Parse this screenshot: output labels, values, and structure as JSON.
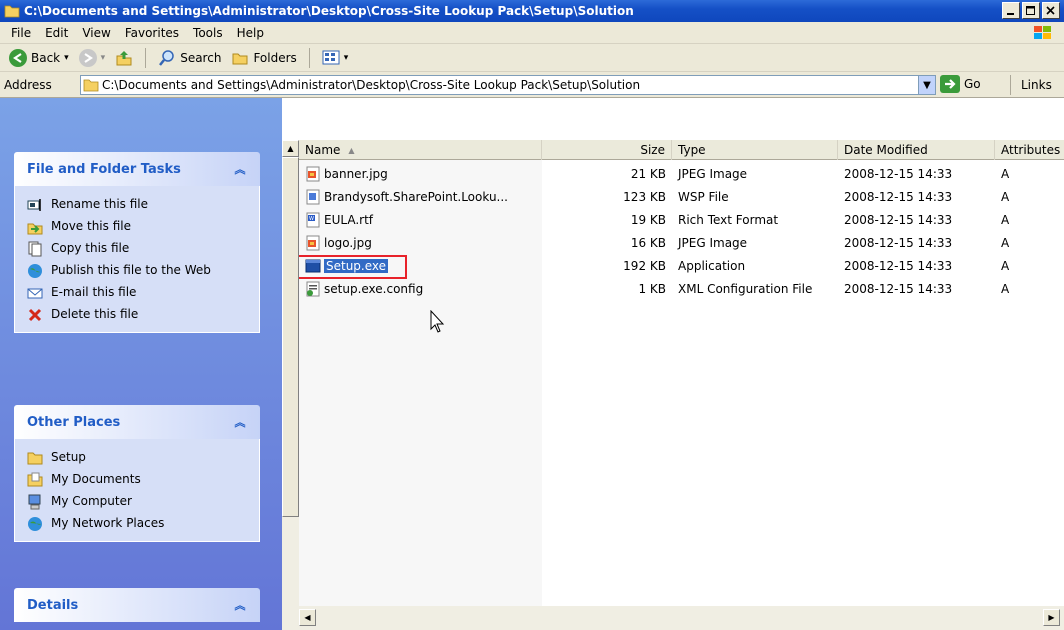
{
  "window": {
    "title": "C:\\Documents and Settings\\Administrator\\Desktop\\Cross-Site Lookup Pack\\Setup\\Solution"
  },
  "menu": {
    "items": [
      "File",
      "Edit",
      "View",
      "Favorites",
      "Tools",
      "Help"
    ]
  },
  "toolbar": {
    "back": "Back",
    "search": "Search",
    "folders": "Folders"
  },
  "address": {
    "label": "Address",
    "value": "C:\\Documents and Settings\\Administrator\\Desktop\\Cross-Site Lookup Pack\\Setup\\Solution",
    "go": "Go",
    "links": "Links"
  },
  "tasks": {
    "file_folder": {
      "title": "File and Folder Tasks",
      "items": [
        {
          "label": "Rename this file",
          "icon": "rename-icon"
        },
        {
          "label": "Move this file",
          "icon": "move-icon"
        },
        {
          "label": "Copy this file",
          "icon": "copy-icon"
        },
        {
          "label": "Publish this file to the Web",
          "icon": "publish-icon"
        },
        {
          "label": "E-mail this file",
          "icon": "email-icon"
        },
        {
          "label": "Delete this file",
          "icon": "delete-icon"
        }
      ]
    },
    "other_places": {
      "title": "Other Places",
      "items": [
        {
          "label": "Setup",
          "icon": "folder-icon"
        },
        {
          "label": "My Documents",
          "icon": "my-documents-icon"
        },
        {
          "label": "My Computer",
          "icon": "my-computer-icon"
        },
        {
          "label": "My Network Places",
          "icon": "network-places-icon"
        }
      ]
    },
    "details": {
      "title": "Details"
    }
  },
  "filelist": {
    "columns": {
      "name": "Name",
      "size": "Size",
      "type": "Type",
      "date": "Date Modified",
      "attr": "Attributes"
    },
    "files": [
      {
        "name": "banner.jpg",
        "size": "21 KB",
        "type": "JPEG Image",
        "date": "2008-12-15 14:33",
        "attr": "A",
        "icon": "jpeg-icon"
      },
      {
        "name": "Brandysoft.SharePoint.Looku...",
        "size": "123 KB",
        "type": "WSP File",
        "date": "2008-12-15 14:33",
        "attr": "A",
        "icon": "wsp-file-icon"
      },
      {
        "name": "EULA.rtf",
        "size": "19 KB",
        "type": "Rich Text Format",
        "date": "2008-12-15 14:33",
        "attr": "A",
        "icon": "rtf-icon"
      },
      {
        "name": "logo.jpg",
        "size": "16 KB",
        "type": "JPEG Image",
        "date": "2008-12-15 14:33",
        "attr": "A",
        "icon": "jpeg-icon"
      },
      {
        "name": "Setup.exe",
        "size": "192 KB",
        "type": "Application",
        "date": "2008-12-15 14:33",
        "attr": "A",
        "icon": "exe-icon",
        "selected": true
      },
      {
        "name": "setup.exe.config",
        "size": "1 KB",
        "type": "XML Configuration File",
        "date": "2008-12-15 14:33",
        "attr": "A",
        "icon": "config-icon"
      }
    ]
  },
  "colors": {
    "title_bar": "#1550c6",
    "task_pane": "#6d87de",
    "selection": "#316ac5",
    "highlight_box": "#e8222a"
  }
}
